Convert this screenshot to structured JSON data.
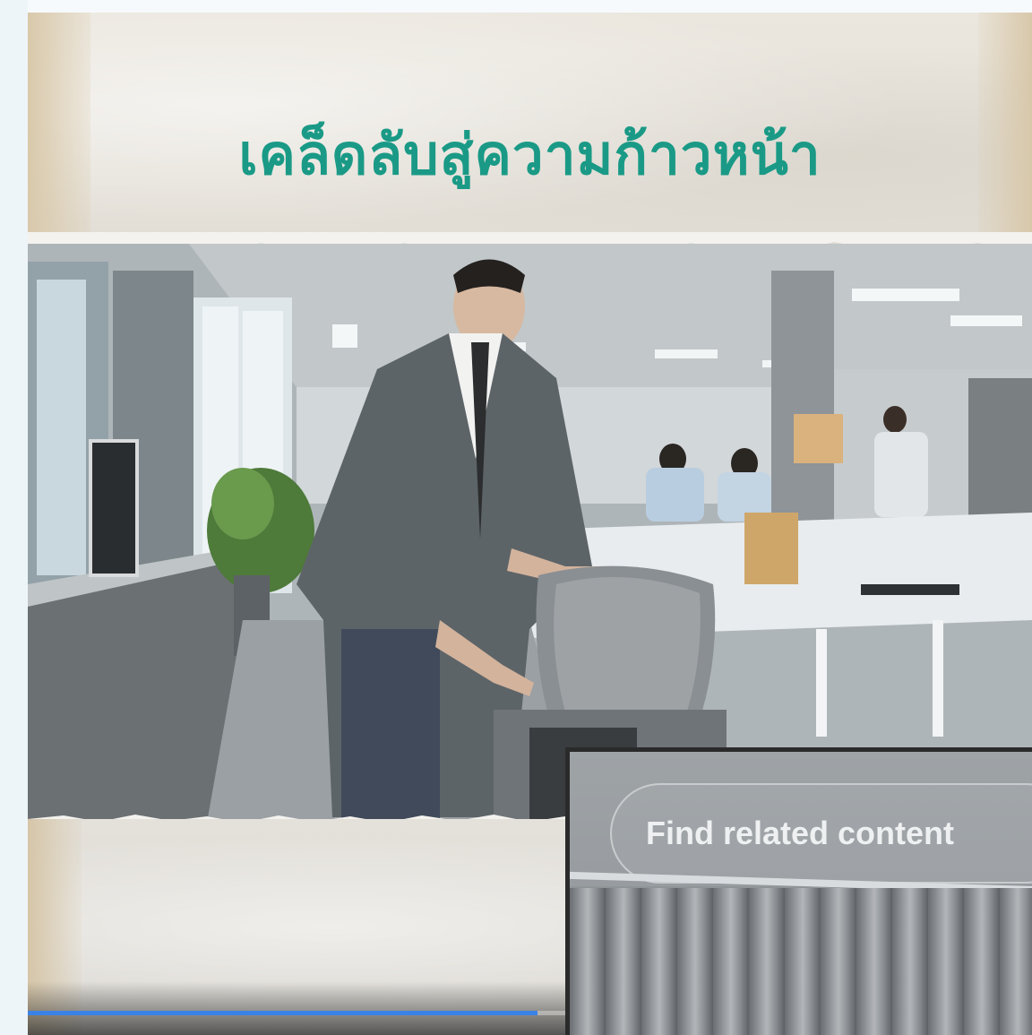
{
  "video": {
    "headline": "เคล็ดลับสู่ความก้าวหน้า",
    "progress_fraction": 0.508
  },
  "related_overlay": {
    "button_label": "Find related content"
  },
  "colors": {
    "headline": "#1a9a86",
    "progress": "#3b82e6",
    "page_background": "#eef4f7"
  },
  "icons": [
    "paper-texture",
    "office-scene"
  ]
}
